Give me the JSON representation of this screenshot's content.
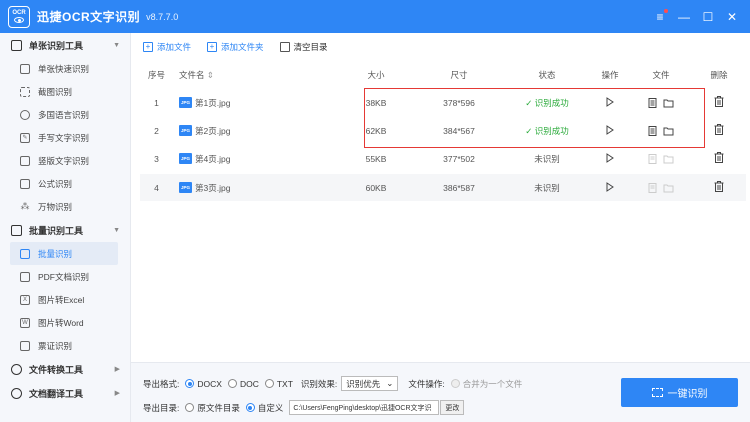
{
  "app": {
    "title": "迅捷OCR文字识别",
    "version": "v8.7.7.0",
    "logo_text": "OCR"
  },
  "window_controls": {
    "menu": "≡",
    "minimize": "—",
    "maximize": "☐",
    "close": "✕"
  },
  "sidebar": {
    "sections": [
      {
        "label": "单张识别工具",
        "items": [
          "单张快速识别",
          "截图识别",
          "多国语言识别",
          "手写文字识别",
          "竖版文字识别",
          "公式识别",
          "万物识别"
        ]
      },
      {
        "label": "批量识别工具",
        "items": [
          "批量识别",
          "PDF文档识别",
          "图片转Excel",
          "图片转Word",
          "票证识别"
        ]
      },
      {
        "label": "文件转换工具",
        "items": []
      },
      {
        "label": "文档翻译工具",
        "items": []
      }
    ],
    "active_item": "批量识别"
  },
  "toolbar": {
    "add_file": "添加文件",
    "add_folder": "添加文件夹",
    "clear": "清空目录"
  },
  "table": {
    "headers": {
      "no": "序号",
      "name": "文件名",
      "size": "大小",
      "dim": "尺寸",
      "status": "状态",
      "op": "操作",
      "file": "文件",
      "del": "删除"
    },
    "rows": [
      {
        "no": "1",
        "name": "第1页.jpg",
        "size": "38KB",
        "dim": "378*596",
        "status": "✓ 识别成功",
        "done": true
      },
      {
        "no": "2",
        "name": "第2页.jpg",
        "size": "62KB",
        "dim": "384*567",
        "status": "✓ 识别成功",
        "done": true
      },
      {
        "no": "3",
        "name": "第4页.jpg",
        "size": "55KB",
        "dim": "377*502",
        "status": "未识别",
        "done": false
      },
      {
        "no": "4",
        "name": "第3页.jpg",
        "size": "60KB",
        "dim": "386*587",
        "status": "未识别",
        "done": false
      }
    ]
  },
  "bottom": {
    "export_format_label": "导出格式:",
    "formats": [
      "DOCX",
      "DOC",
      "TXT"
    ],
    "selected_format": "DOCX",
    "effect_label": "识别效果:",
    "effect_value": "识别优先",
    "file_op_label": "文件操作:",
    "merge_label": "合并为一个文件",
    "export_dir_label": "导出目录:",
    "dir_options": [
      "原文件目录",
      "自定义"
    ],
    "selected_dir": "自定义",
    "path_value": "C:\\Users\\FengPing\\desktop\\迅捷OCR文字识",
    "change_label": "更改",
    "start_button": "一键识别"
  },
  "colors": {
    "accent": "#2e86f5",
    "success": "#2aaa3a",
    "highlight": "#e53935"
  }
}
